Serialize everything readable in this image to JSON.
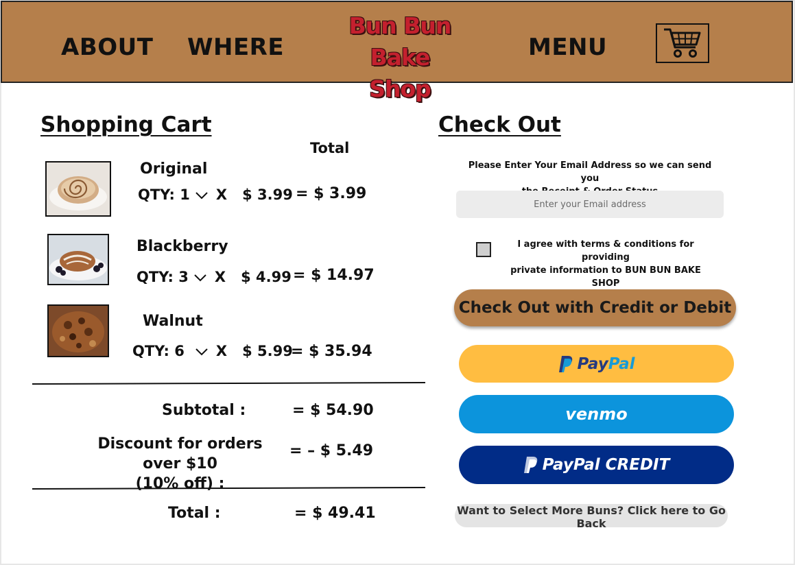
{
  "header": {
    "nav": {
      "about": "ABOUT",
      "where": "WHERE",
      "menu": "MENU"
    },
    "logo_line1": "Bun Bun",
    "logo_line2": "Bake Shop",
    "cart_icon": "shopping-cart-icon"
  },
  "cart": {
    "title": "Shopping Cart",
    "total_column_label": "Total",
    "items": [
      {
        "name": "Original",
        "qty_label": "QTY: 1",
        "times": "X",
        "price": "$ 3.99",
        "total": "=  $ 3.99"
      },
      {
        "name": "Blackberry",
        "qty_label": "QTY: 3",
        "times": "X",
        "price": "$ 4.99",
        "total": "=  $ 14.97"
      },
      {
        "name": "Walnut",
        "qty_label": "QTY: 6",
        "times": "X",
        "price": "$ 5.99",
        "total": "=  $ 35.94"
      }
    ],
    "subtotal_label": "Subtotal :",
    "subtotal_value": "=  $ 54.90",
    "discount_label_1": "Discount for orders over $10",
    "discount_label_2": "(10%  off) :",
    "discount_value": "=  – $ 5.49",
    "total_label": "Total :",
    "total_value": "=  $ 49.41"
  },
  "checkout": {
    "title": "Check Out",
    "email_prompt_1": "Please Enter Your Email Address so we can send you",
    "email_prompt_2": "the Receipt & Order Status",
    "email_placeholder": "Enter your Email address",
    "email_value": "",
    "agree_1": "I agree with terms & conditions for providing",
    "agree_2": "private information to BUN BUN BAKE SHOP",
    "card_button": "Check Out with Credit or Debit",
    "paypal_pay": "Pay",
    "paypal_pal": "Pal",
    "venmo": "venmo",
    "paypal_credit": "PayPal CREDIT",
    "back_button": "Want to Select More Buns? Click here to Go Back"
  },
  "colors": {
    "header_bg": "#b57f4b",
    "logo_red": "#c4202e",
    "paypal_yellow": "#ffbd41",
    "venmo_blue": "#0c94dc",
    "paypal_credit_navy": "#012c87",
    "paypal_dark_blue": "#253b80",
    "paypal_light_blue": "#179bd7"
  }
}
